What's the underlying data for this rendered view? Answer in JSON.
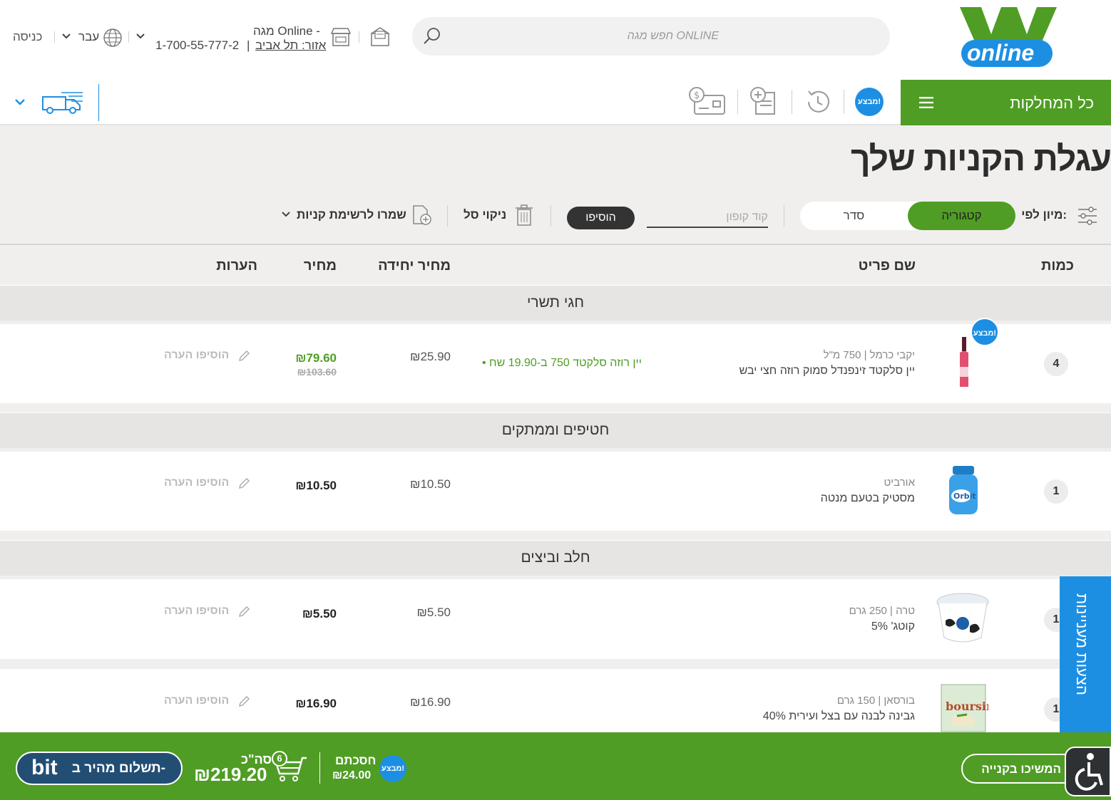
{
  "header": {
    "logo_text": "online",
    "search_placeholder": "חפש מגה ONLINE",
    "store_line1": "מגה Online -",
    "store_area_label": "אזור: תל אביב",
    "store_phone": "1-700-55-777-2",
    "language": "עבר",
    "login": "כניסה"
  },
  "nav": {
    "all_departments": "כל המחלקות",
    "deals_badge": "מבצע!"
  },
  "page": {
    "title": "עגלת הקניות שלך",
    "sort_label": "מיון לפי:",
    "sort_category": "קטגוריה",
    "sort_order": "סדר",
    "coupon_placeholder": "קוד קופון",
    "add_button": "הוסיפו",
    "clean_cart": "ניקוי סל",
    "save_to_list": "שמרו לרשימת קניות"
  },
  "table": {
    "headers": {
      "qty": "כמות",
      "name": "שם פריט",
      "unit_price": "מחיר יחידה",
      "price": "מחיר",
      "notes": "הערות"
    },
    "categories": [
      {
        "title": "חגי תשרי",
        "items": [
          {
            "qty": "4",
            "brand": "יקבי כרמל | 750 מ\"ל",
            "name": "יין סלקטד זינפנדל סמוק רוזה חצי יבש",
            "promo": "• יין רוזה סלקטד 750 ב-19.90 שח",
            "unit_price": "₪25.90",
            "price": "₪79.60",
            "old_price": "₪103.60",
            "note": "הוסיפו הערה",
            "deal_badge": "מבצע!"
          }
        ]
      },
      {
        "title": "חטיפים וממתקים",
        "items": [
          {
            "qty": "1",
            "brand": "אורביט",
            "name": "מסטיק בטעם מנטה",
            "unit_price": "₪10.50",
            "price": "₪10.50",
            "note": "הוסיפו הערה"
          }
        ]
      },
      {
        "title": "חלב וביצים",
        "items": [
          {
            "qty": "1",
            "brand": "טרה | 250 גרם",
            "name": "קוטג' 5%",
            "unit_price": "₪5.50",
            "price": "₪5.50",
            "note": "הוסיפו הערה"
          },
          {
            "qty": "1",
            "brand": "בורסאן | 150 גרם",
            "name": "גבינה לבנה עם בצל ועירית 40%",
            "unit_price": "₪16.90",
            "price": "₪16.90",
            "note": "הוסיפו הערה"
          }
        ]
      }
    ]
  },
  "footer": {
    "continue": "המשיכו בקנייה",
    "deals_badge": "מבצע!",
    "saved_label": "חסכתם",
    "saved_value": "₪24.00",
    "cart_count": "6",
    "total_label": "סה\"כ",
    "total_value": "₪219.20",
    "bit_label": "תשלום מהיר ב-",
    "bit_logo": "bit"
  },
  "side": {
    "tab_label": "הצעות מעניינות"
  },
  "colors": {
    "brand_green": "#4f9d24",
    "accent_blue": "#1d8fe3"
  }
}
